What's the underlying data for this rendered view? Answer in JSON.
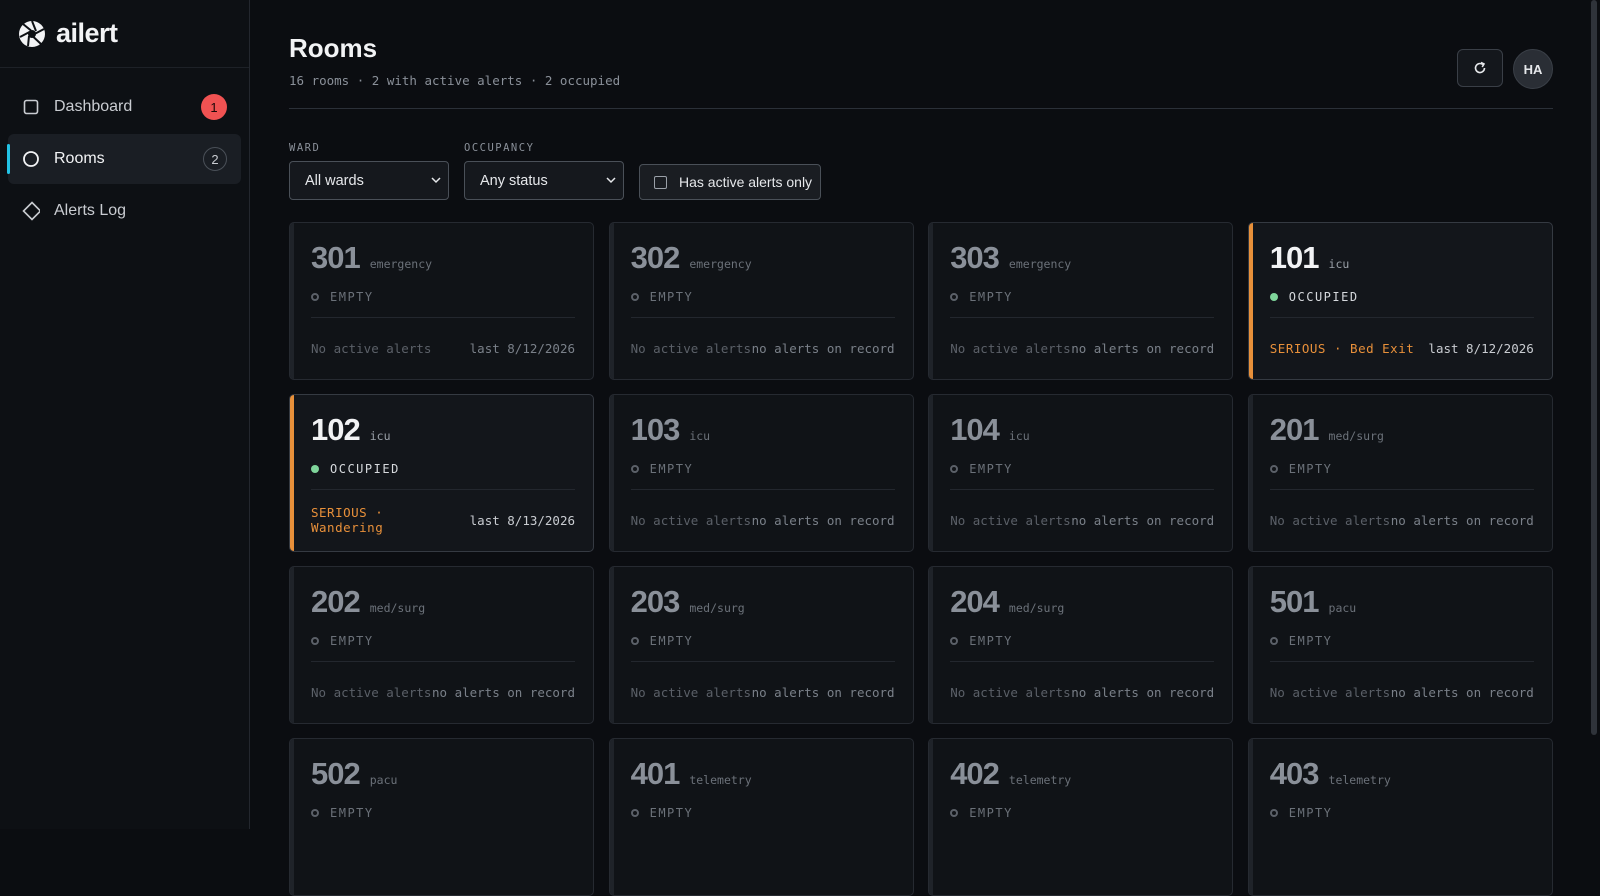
{
  "app": {
    "name": "ailert"
  },
  "sidebar": {
    "items": [
      {
        "label": "Dashboard",
        "badge": "1",
        "icon": "square-icon"
      },
      {
        "label": "Rooms",
        "badge": "2",
        "icon": "circle-icon"
      },
      {
        "label": "Alerts Log",
        "icon": "diamond-icon"
      }
    ]
  },
  "header": {
    "title": "Rooms",
    "subtitle": "16 rooms · 2 with active alerts · 2 occupied",
    "avatar_initials": "HA",
    "refresh_icon": "refresh-icon"
  },
  "filters": {
    "ward": {
      "label": "WARD",
      "value": "All wards"
    },
    "occupancy": {
      "label": "OCCUPANCY",
      "value": "Any status"
    },
    "active_only": {
      "label": "Has active alerts only",
      "checked": false
    }
  },
  "rooms": [
    {
      "number": "301",
      "ward": "emergency",
      "status": "EMPTY",
      "left": "No active alerts",
      "right": "last 8/12/2026"
    },
    {
      "number": "302",
      "ward": "emergency",
      "status": "EMPTY",
      "left": "No active alerts",
      "right": "no alerts on record"
    },
    {
      "number": "303",
      "ward": "emergency",
      "status": "EMPTY",
      "left": "No active alerts",
      "right": "no alerts on record"
    },
    {
      "number": "101",
      "ward": "icu",
      "status": "OCCUPIED",
      "left": "SERIOUS · Bed Exit",
      "right": "last 8/12/2026"
    },
    {
      "number": "102",
      "ward": "icu",
      "status": "OCCUPIED",
      "left": "SERIOUS · Wandering",
      "right": "last 8/13/2026"
    },
    {
      "number": "103",
      "ward": "icu",
      "status": "EMPTY",
      "left": "No active alerts",
      "right": "no alerts on record"
    },
    {
      "number": "104",
      "ward": "icu",
      "status": "EMPTY",
      "left": "No active alerts",
      "right": "no alerts on record"
    },
    {
      "number": "201",
      "ward": "med/surg",
      "status": "EMPTY",
      "left": "No active alerts",
      "right": "no alerts on record"
    },
    {
      "number": "202",
      "ward": "med/surg",
      "status": "EMPTY",
      "left": "No active alerts",
      "right": "no alerts on record"
    },
    {
      "number": "203",
      "ward": "med/surg",
      "status": "EMPTY",
      "left": "No active alerts",
      "right": "no alerts on record"
    },
    {
      "number": "204",
      "ward": "med/surg",
      "status": "EMPTY",
      "left": "No active alerts",
      "right": "no alerts on record"
    },
    {
      "number": "501",
      "ward": "pacu",
      "status": "EMPTY",
      "left": "No active alerts",
      "right": "no alerts on record"
    },
    {
      "number": "502",
      "ward": "pacu",
      "status": "EMPTY"
    },
    {
      "number": "401",
      "ward": "telemetry",
      "status": "EMPTY"
    },
    {
      "number": "402",
      "ward": "telemetry",
      "status": "EMPTY"
    },
    {
      "number": "403",
      "ward": "telemetry",
      "status": "EMPTY"
    }
  ]
}
